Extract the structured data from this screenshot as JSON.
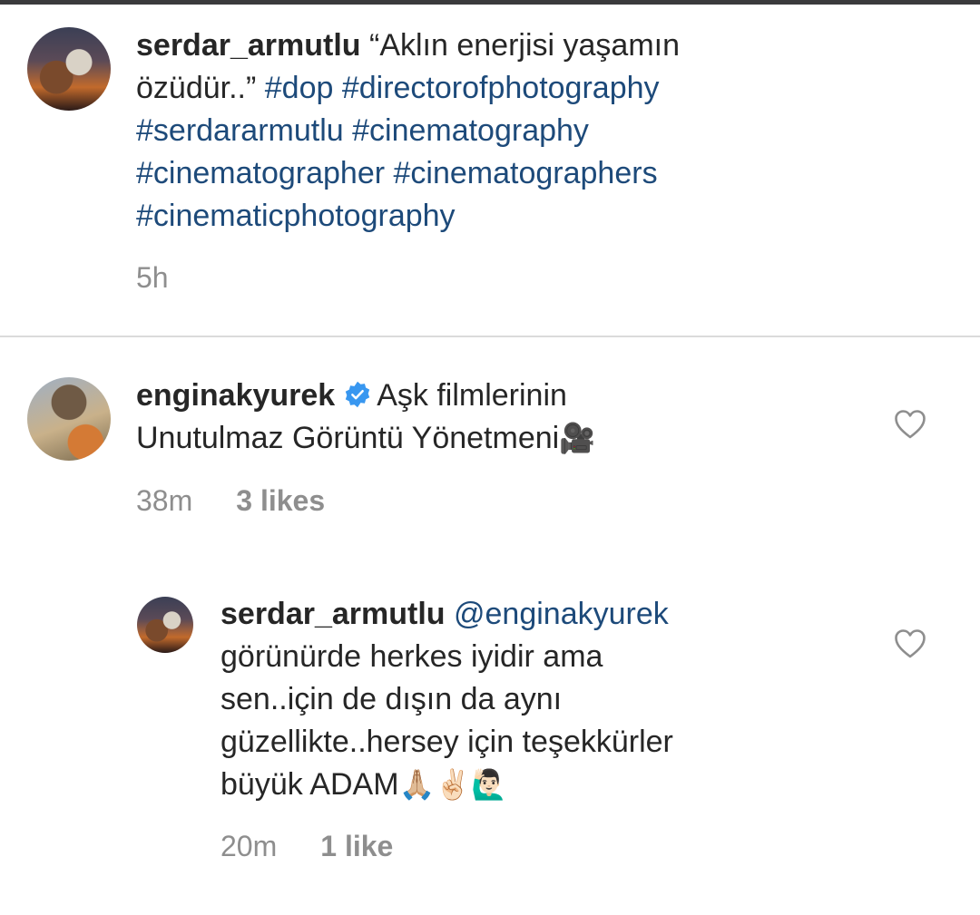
{
  "caption": {
    "username": "serdar_armutlu",
    "text_line1": "“Aklın enerjisi yaşamın",
    "text_line2_start": "özüdür..” ",
    "hashtags_line2": "#dop #directorofphotography",
    "hashtags_line3": "#serdararmutlu #cinematography",
    "hashtags_line4": "#cinematographer #cinematographers",
    "hashtags_line5": "#cinematicphotography",
    "time": "5h"
  },
  "comment": {
    "username": "enginakyurek",
    "verified": true,
    "text_line1": "Aşk filmlerinin",
    "text_line2": "Unutulmaz Görüntü Yönetmeni",
    "emoji": "🎥",
    "time": "38m",
    "likes": "3 likes",
    "like_icon": "heart-outline-icon"
  },
  "reply": {
    "username": "serdar_armutlu",
    "mention": "@enginakyurek",
    "text_line1": "görünürde herkes iyidir ama",
    "text_line2": "sen..için de dışın da aynı",
    "text_line3": "güzellikte..hersey için teşekkürler",
    "text_line4": "büyük ADAM",
    "emojis": "🙏🏼✌🏻🙋🏻‍♂️",
    "time": "20m",
    "likes": "1 like",
    "like_icon": "heart-outline-icon"
  },
  "colors": {
    "link": "#1d4a7a",
    "meta": "#8e8e8e",
    "verified": "#3897f0"
  }
}
